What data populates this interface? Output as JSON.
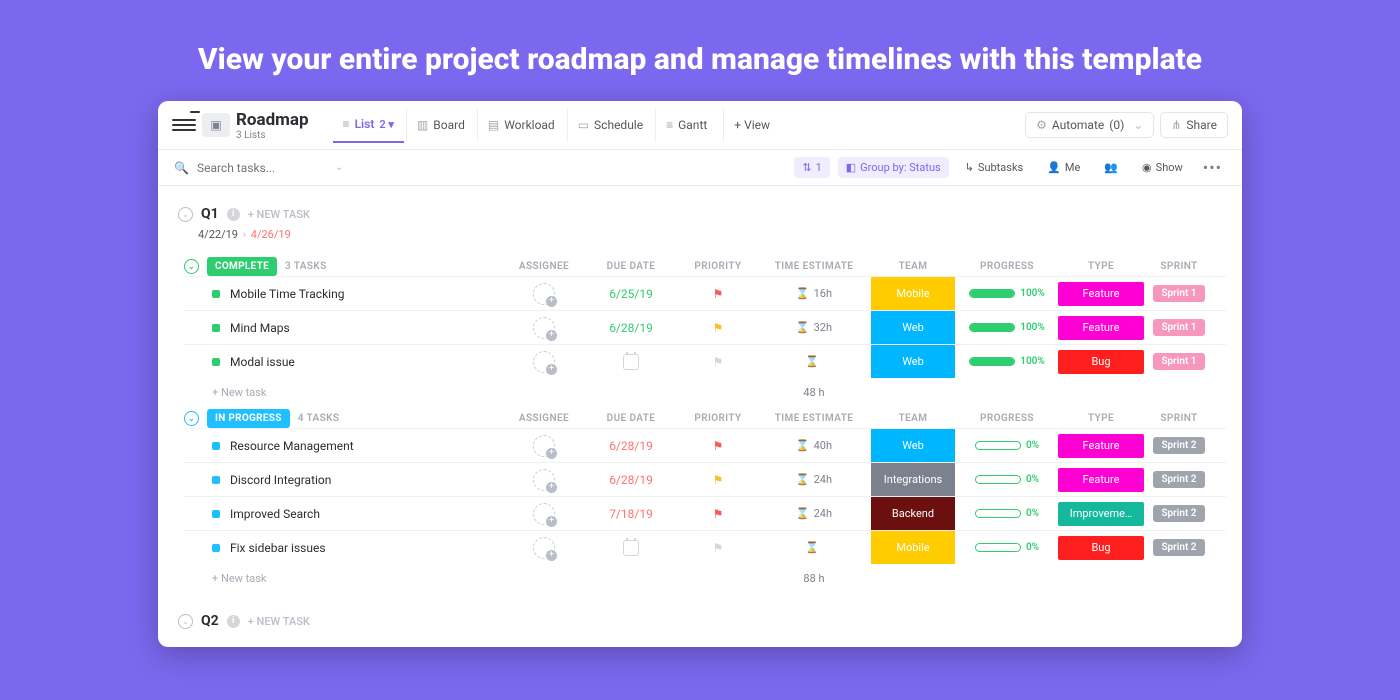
{
  "hero": "View your entire project roadmap and manage timelines with this template",
  "header": {
    "burger_badge": "",
    "title": "Roadmap",
    "subtitle": "3 Lists",
    "tabs": [
      {
        "label": "List",
        "badge": "2",
        "active": true,
        "caret": true
      },
      {
        "label": "Board"
      },
      {
        "label": "Workload"
      },
      {
        "label": "Schedule"
      },
      {
        "label": "Gantt"
      }
    ],
    "add_view": "+ View",
    "automate_label": "Automate",
    "automate_count": "(0)",
    "share": "Share"
  },
  "toolbar": {
    "search_placeholder": "Search tasks...",
    "filter_badge": "1",
    "group_by": "Group by: Status",
    "subtasks": "Subtasks",
    "me": "Me",
    "show": "Show"
  },
  "quarters": [
    {
      "name": "Q1",
      "new": "+ NEW TASK",
      "d1": "4/22/19",
      "d2": "4/26/19"
    },
    {
      "name": "Q2",
      "new": "+ NEW TASK"
    }
  ],
  "columns": [
    "ASSIGNEE",
    "DUE DATE",
    "PRIORITY",
    "TIME ESTIMATE",
    "TEAM",
    "PROGRESS",
    "TYPE",
    "SPRINT"
  ],
  "groups": [
    {
      "status_label": "COMPLETE",
      "status_color": "green",
      "count_label": "3 TASKS",
      "rows": [
        {
          "name": "Mobile Time Tracking",
          "due": "6/25/19",
          "due_cls": "green",
          "flag": "red",
          "est": "16h",
          "team": "Mobile",
          "team_bg": "#ffcc00",
          "progress": 100,
          "type": "Feature",
          "type_bg": "#ff00d4",
          "sprint": "Sprint 1",
          "sprint_cls": "pink"
        },
        {
          "name": "Mind Maps",
          "due": "6/28/19",
          "due_cls": "green",
          "flag": "yellow",
          "est": "32h",
          "team": "Web",
          "team_bg": "#00b7ff",
          "progress": 100,
          "type": "Feature",
          "type_bg": "#ff00d4",
          "sprint": "Sprint 1",
          "sprint_cls": "pink"
        },
        {
          "name": "Modal issue",
          "due": "",
          "due_cls": "grey",
          "flag": "grey",
          "est": "",
          "team": "Web",
          "team_bg": "#00b7ff",
          "progress": 100,
          "type": "Bug",
          "type_bg": "#ff1f1f",
          "sprint": "Sprint 1",
          "sprint_cls": "pink"
        }
      ],
      "new_task": "+ New task",
      "total": "48 h"
    },
    {
      "status_label": "IN PROGRESS",
      "status_color": "blue",
      "count_label": "4 TASKS",
      "rows": [
        {
          "name": "Resource Management",
          "due": "6/28/19",
          "due_cls": "red",
          "flag": "red",
          "est": "40h",
          "team": "Web",
          "team_bg": "#00b7ff",
          "progress": 0,
          "type": "Feature",
          "type_bg": "#ff00d4",
          "sprint": "Sprint 2",
          "sprint_cls": "grey"
        },
        {
          "name": "Discord Integration",
          "due": "6/28/19",
          "due_cls": "red",
          "flag": "yellow",
          "est": "24h",
          "team": "Integrations",
          "team_bg": "#7c828d",
          "progress": 0,
          "type": "Feature",
          "type_bg": "#ff00d4",
          "sprint": "Sprint 2",
          "sprint_cls": "grey"
        },
        {
          "name": "Improved Search",
          "due": "7/18/19",
          "due_cls": "red",
          "flag": "red",
          "est": "24h",
          "team": "Backend",
          "team_bg": "#6b0f0f",
          "progress": 0,
          "type": "Improveme…",
          "type_bg": "#14b89c",
          "sprint": "Sprint 2",
          "sprint_cls": "grey"
        },
        {
          "name": "Fix sidebar issues",
          "due": "",
          "due_cls": "grey",
          "flag": "grey",
          "est": "",
          "team": "Mobile",
          "team_bg": "#ffcc00",
          "progress": 0,
          "type": "Bug",
          "type_bg": "#ff1f1f",
          "sprint": "Sprint 2",
          "sprint_cls": "grey"
        }
      ],
      "new_task": "+ New task",
      "total": "88 h"
    }
  ]
}
